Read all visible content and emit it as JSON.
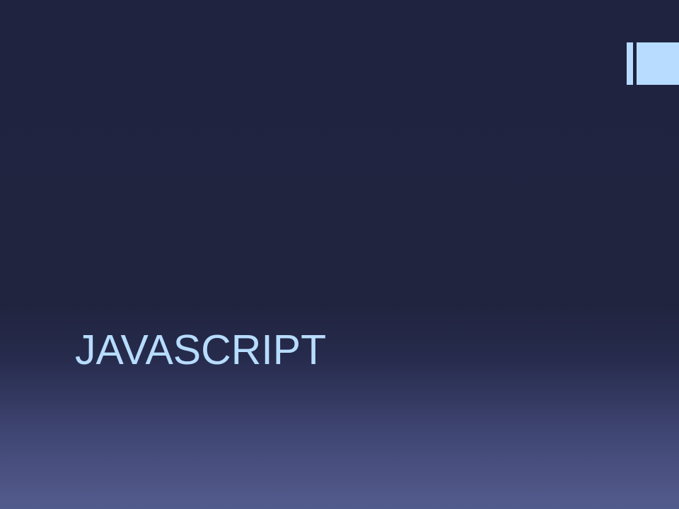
{
  "slide": {
    "title": "JAVASCRIPT"
  },
  "colors": {
    "background_top": "#1f2340",
    "background_bottom": "#525c8c",
    "accent": "#b7dcff"
  }
}
